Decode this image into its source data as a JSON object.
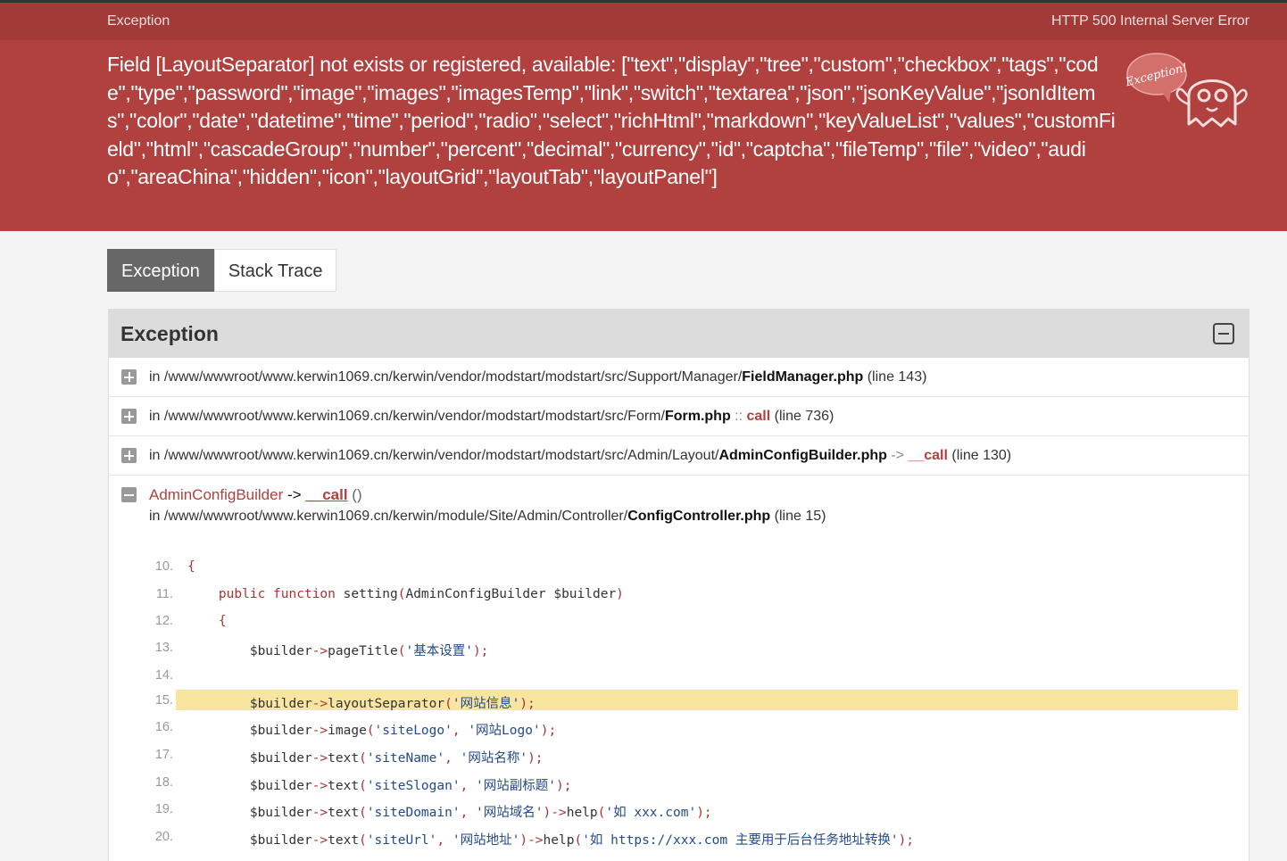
{
  "header": {
    "label": "Exception",
    "status": "HTTP 500 Internal Server Error",
    "message": "Field [LayoutSeparator] not exists or registered, available: [\"text\",\"display\",\"tree\",\"custom\",\"checkbox\",\"tags\",\"code\",\"type\",\"password\",\"image\",\"images\",\"imagesTemp\",\"link\",\"switch\",\"textarea\",\"json\",\"jsonKeyValue\",\"jsonIdItems\",\"color\",\"date\",\"datetime\",\"time\",\"period\",\"radio\",\"select\",\"richHtml\",\"markdown\",\"keyValueList\",\"values\",\"customField\",\"html\",\"cascadeGroup\",\"number\",\"percent\",\"decimal\",\"currency\",\"id\",\"captcha\",\"fileTemp\",\"file\",\"video\",\"audio\",\"areaChina\",\"hidden\",\"icon\",\"layoutGrid\",\"layoutTab\",\"layoutPanel\"]",
    "ghost_text": "Exception!"
  },
  "tabs": [
    {
      "label": "Exception",
      "active": true
    },
    {
      "label": "Stack Trace",
      "active": false
    }
  ],
  "panel": {
    "title": "Exception",
    "frames": [
      {
        "prefix": "in ",
        "path": "/www/wwwroot/www.kerwin1069.cn/kerwin/vendor/modstart/modstart/src/Support/Manager/",
        "file": "FieldManager.php",
        "sep": "",
        "fn": "",
        "line": " (line 143)"
      },
      {
        "prefix": "in ",
        "path": "/www/wwwroot/www.kerwin1069.cn/kerwin/vendor/modstart/modstart/src/Form/",
        "file": "Form.php",
        "sep": " :: ",
        "fn": "call",
        "line": " (line 736)"
      },
      {
        "prefix": "in ",
        "path": "/www/wwwroot/www.kerwin1069.cn/kerwin/vendor/modstart/modstart/src/Admin/Layout/",
        "file": "AdminConfigBuilder.php",
        "sep": " -> ",
        "fn": "__call",
        "line": " (line 130)"
      }
    ],
    "open_frame": {
      "cls": "AdminConfigBuilder",
      "arrow": " -> ",
      "fn": "__call",
      "paren": " ()",
      "prefix": "in ",
      "path": "/www/wwwroot/www.kerwin1069.cn/kerwin/module/Site/Admin/Controller/",
      "file": "ConfigController.php",
      "line": " (line 15)"
    },
    "code_lines": [
      {
        "num": "10.",
        "text": "{"
      },
      {
        "num": "11.",
        "text": "    public function setting(AdminConfigBuilder $builder)"
      },
      {
        "num": "12.",
        "text": "    {"
      },
      {
        "num": "13.",
        "text": "        $builder->pageTitle('基本设置');"
      },
      {
        "num": "14.",
        "text": ""
      },
      {
        "num": "15.",
        "text": "        $builder->layoutSeparator('网站信息');",
        "highlight": true
      },
      {
        "num": "16.",
        "text": "        $builder->image('siteLogo', '网站Logo');"
      },
      {
        "num": "17.",
        "text": "        $builder->text('siteName', '网站名称');"
      },
      {
        "num": "18.",
        "text": "        $builder->text('siteSlogan', '网站副标题');"
      },
      {
        "num": "19.",
        "text": "        $builder->text('siteDomain', '网站域名')->help('如 xxx.com');"
      },
      {
        "num": "20.",
        "text": "        $builder->text('siteUrl', '网站地址')->help('如 https://xxx.com 主要用于后台任务地址转换');"
      }
    ]
  }
}
